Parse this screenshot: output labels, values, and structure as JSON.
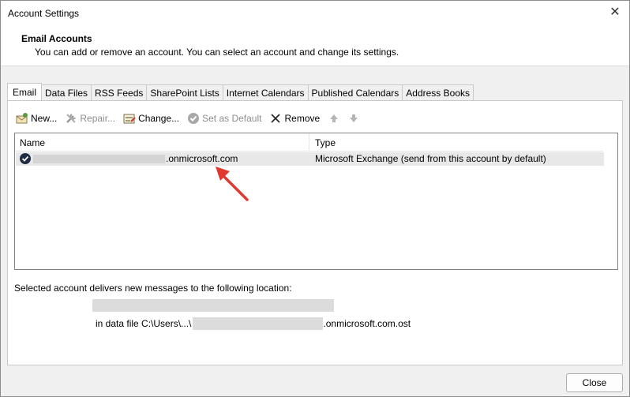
{
  "window": {
    "title": "Account Settings",
    "close_glyph": "✕"
  },
  "header": {
    "title": "Email Accounts",
    "subtitle": "You can add or remove an account. You can select an account and change its settings."
  },
  "tabs": [
    {
      "label": "Email",
      "active": true
    },
    {
      "label": "Data Files"
    },
    {
      "label": "RSS Feeds"
    },
    {
      "label": "SharePoint Lists"
    },
    {
      "label": "Internet Calendars"
    },
    {
      "label": "Published Calendars"
    },
    {
      "label": "Address Books"
    }
  ],
  "toolbar": {
    "new_label": "New...",
    "repair_label": "Repair...",
    "change_label": "Change...",
    "set_default_label": "Set as Default",
    "remove_label": "Remove"
  },
  "list": {
    "col_name": "Name",
    "col_type": "Type",
    "rows": [
      {
        "name_suffix": ".onmicrosoft.com",
        "type": "Microsoft Exchange (send from this account by default)"
      }
    ]
  },
  "delivery": {
    "label": "Selected account delivers new messages to the following location:",
    "data_file_prefix": "in data file C:\\Users\\...\\",
    "data_file_suffix": ".onmicrosoft.com.ost"
  },
  "footer": {
    "close_label": "Close"
  },
  "colors": {
    "annotation_arrow": "#e03a2f",
    "selected_row": "#e8e8e8"
  }
}
